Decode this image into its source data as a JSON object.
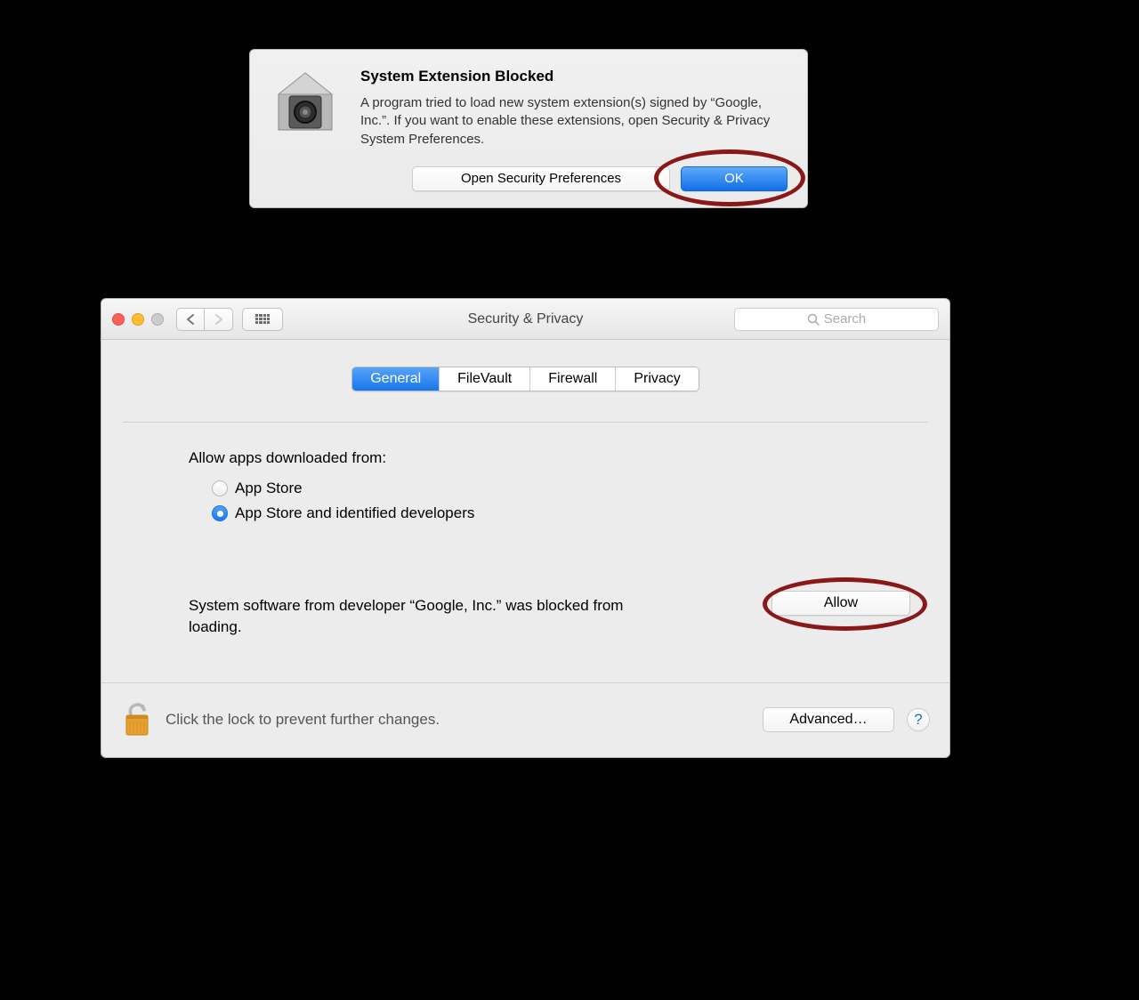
{
  "modal": {
    "title": "System Extension Blocked",
    "text": "A program tried to load new system extension(s) signed by “Google, Inc.”.  If you want to enable these extensions, open Security & Privacy System Preferences.",
    "open_prefs_label": "Open Security Preferences",
    "ok_label": "OK"
  },
  "prefs": {
    "window_title": "Security & Privacy",
    "search_placeholder": "Search",
    "tabs": {
      "general": "General",
      "filevault": "FileVault",
      "firewall": "Firewall",
      "privacy": "Privacy"
    },
    "allow_label": "Allow apps downloaded from:",
    "radio_appstore": "App Store",
    "radio_identified": "App Store and identified developers",
    "blocked_text": "System software from developer “Google, Inc.” was blocked from loading.",
    "allow_button": "Allow",
    "lock_text": "Click the lock to prevent further changes.",
    "advanced_label": "Advanced…",
    "help_label": "?"
  }
}
